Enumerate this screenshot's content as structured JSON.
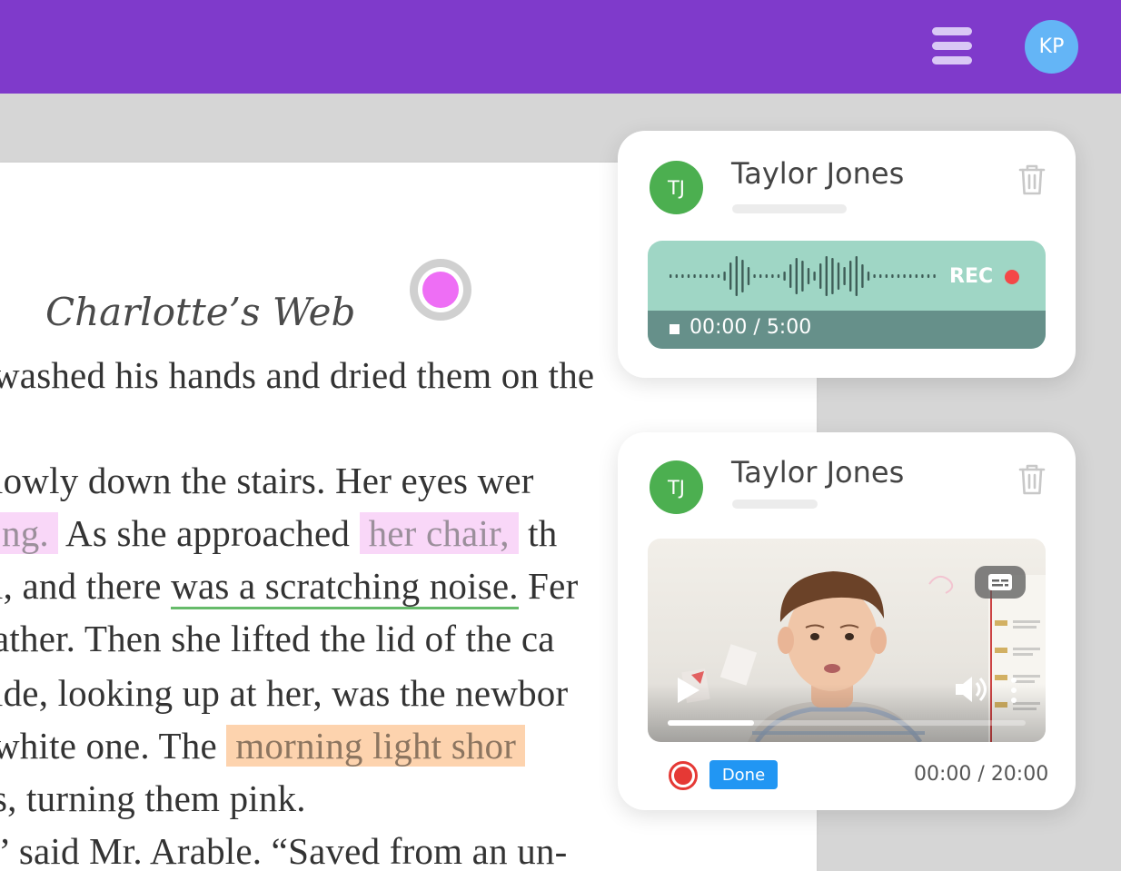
{
  "header": {
    "menu_icon": "hamburger-menu-icon",
    "user_initials": "KP",
    "background": "#7f3acb"
  },
  "document": {
    "title": "Charlotte’s Web",
    "lines": [
      {
        "parts": [
          {
            "text": "washed his hands and dried them on the",
            "style": "plain"
          }
        ]
      },
      {
        "parts": [
          {
            "text": "lowly  down  the  stairs.  Her  eyes  wer",
            "style": "plain"
          }
        ]
      },
      {
        "parts": [
          {
            "text": "ng.",
            "style": "pink"
          },
          {
            "text": "  As  she  approached  ",
            "style": "plain"
          },
          {
            "text": "her  chair,",
            "style": "pink"
          },
          {
            "text": "  th",
            "style": "plain"
          }
        ]
      },
      {
        "parts": [
          {
            "text": "l, and there ",
            "style": "plain"
          },
          {
            "text": "was a scratching noise.",
            "style": "green"
          },
          {
            "text": " Fer",
            "style": "plain"
          }
        ]
      },
      {
        "parts": [
          {
            "text": "ather. Then she lifted the lid of the ca",
            "style": "plain"
          }
        ]
      },
      {
        "parts": [
          {
            "text": "ide, looking up at her, was the newbor",
            "style": "plain"
          }
        ]
      },
      {
        "parts": [
          {
            "text": " white  one.  The  ",
            "style": "plain"
          },
          {
            "text": "morning  light  shor",
            "style": "orange"
          }
        ]
      },
      {
        "parts": [
          {
            "text": "s, turning them pink.",
            "style": "plain"
          }
        ]
      },
      {
        "parts": [
          {
            "text": "” said Mr. Arable. “Saved from an un-",
            "style": "plain"
          }
        ]
      }
    ]
  },
  "cards": [
    {
      "initials": "TJ",
      "name": "Taylor Jones",
      "recorder": {
        "label": "REC",
        "elapsed": "00:00",
        "separator": " / ",
        "limit": "5:00"
      }
    },
    {
      "initials": "TJ",
      "name": "Taylor Jones",
      "video": {
        "progress_fraction": 0.24,
        "done_label": "Done",
        "elapsed": "00:00",
        "separator": " / ",
        "duration": "20:00"
      }
    }
  ]
}
